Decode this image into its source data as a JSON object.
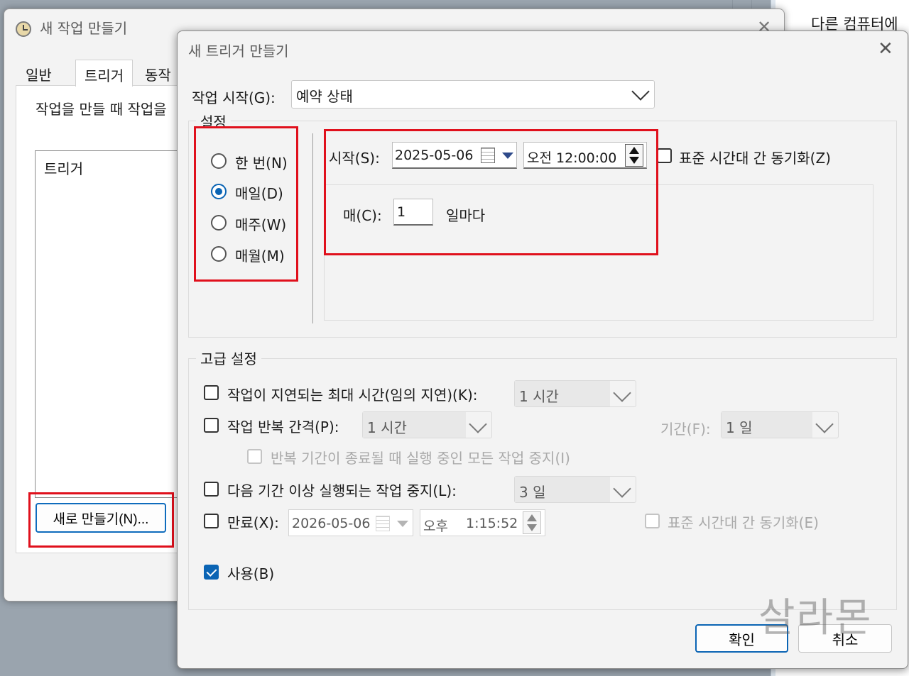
{
  "background": {
    "right_text": "다른 컴퓨터에"
  },
  "parent_window": {
    "title": "새 작업 만들기",
    "tabs": [
      {
        "label": "일반"
      },
      {
        "label": "트리거"
      },
      {
        "label": "동작"
      }
    ],
    "description": "작업을 만들 때 작업을",
    "list_header": "트리거",
    "new_button": "새로 만들기(N)..."
  },
  "dialog": {
    "title": "새 트리거 만들기",
    "begin_task": {
      "label": "작업 시작(G):",
      "value": "예약 상태"
    },
    "settings": {
      "legend": "설정",
      "options": [
        {
          "label": "한 번(N)",
          "selected": false
        },
        {
          "label": "매일(D)",
          "selected": true
        },
        {
          "label": "매주(W)",
          "selected": false
        },
        {
          "label": "매월(M)",
          "selected": false
        }
      ],
      "start_label": "시작(S):",
      "start_date": "2025-05-06",
      "start_time": "오전 12:00:00",
      "sync_tz_label": "표준 시간대 간 동기화(Z)",
      "recur_label": "매(C):",
      "recur_value": "1",
      "recur_unit": "일마다"
    },
    "advanced": {
      "legend": "고급 설정",
      "delay_label": "작업이 지연되는 최대 시간(임의 지연)(K):",
      "delay_value": "1 시간",
      "repeat_label": "작업 반복 간격(P):",
      "repeat_value": "1 시간",
      "duration_label": "기간(F):",
      "duration_value": "1 일",
      "stop_all_label": "반복 기간이 종료될 때 실행 중인 모든 작업 중지(I)",
      "stop_longer_label": "다음 기간 이상 실행되는 작업 중지(L):",
      "stop_longer_value": "3 일",
      "expire_label": "만료(X):",
      "expire_date": "2026-05-06",
      "expire_ampm": "오후",
      "expire_time": "1:15:52",
      "expire_sync_label": "표준 시간대 간 동기화(E)",
      "enabled_label": "사용(B)"
    },
    "ok_button": "확인",
    "cancel_button": "취소"
  },
  "watermark": "살라몬",
  "colors": {
    "accent": "#0a64b4",
    "highlight": "#e0101c"
  }
}
